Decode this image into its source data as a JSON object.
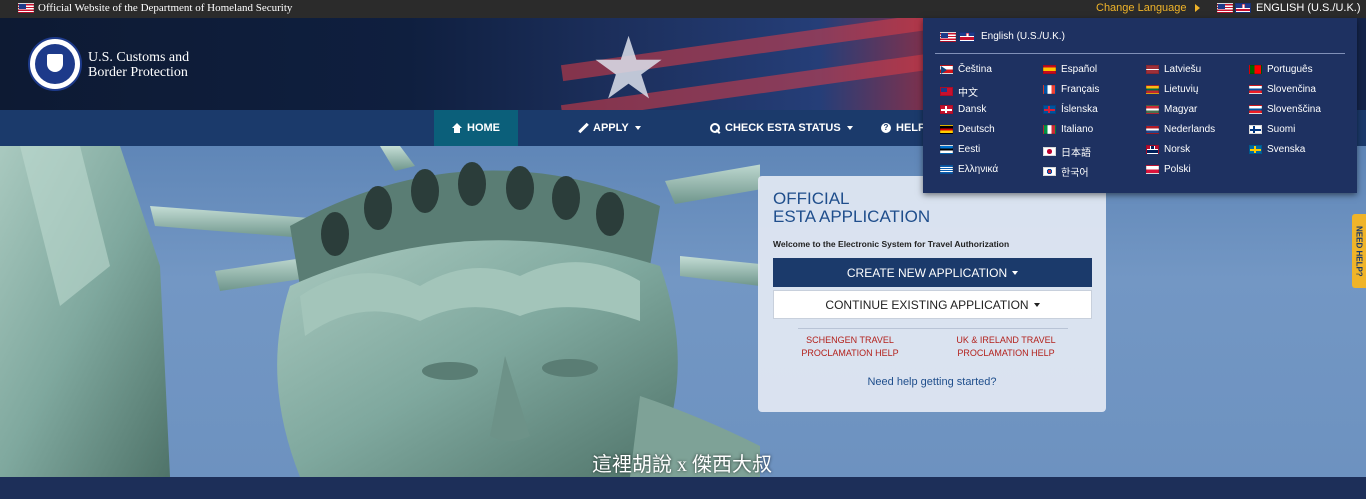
{
  "topbar": {
    "official_text": "Official Website of the Department of Homeland Security",
    "change_language": "Change Language",
    "current_language": "ENGLISH (U.S./U.K.)"
  },
  "header": {
    "brand_line1": "U.S. Customs and",
    "brand_line2": "Border Protection"
  },
  "nav": {
    "home": "HOME",
    "apply": "APPLY",
    "check_status": "CHECK ESTA STATUS",
    "help": "HELP"
  },
  "card": {
    "title_line1": "OFFICIAL",
    "title_line2": "ESTA APPLICATION",
    "welcome": "Welcome to the Electronic System for Travel Authorization",
    "create_button": "CREATE NEW APPLICATION",
    "continue_button": "CONTINUE EXISTING APPLICATION",
    "schengen_line1": "SCHENGEN TRAVEL",
    "schengen_line2": "PROCLAMATION HELP",
    "uk_line1": "UK & IRELAND TRAVEL",
    "uk_line2": "PROCLAMATION HELP",
    "getting_started": "Need help getting started?"
  },
  "side_tab": "NEED HELP?",
  "watermark": "這裡胡說 x 傑西大叔",
  "language_menu": {
    "current": "English (U.S./U.K.)",
    "languages": [
      {
        "label": "Čeština",
        "flag": "cz"
      },
      {
        "label": "Español",
        "flag": "es"
      },
      {
        "label": "Latviešu",
        "flag": "lv"
      },
      {
        "label": "Português",
        "flag": "pt"
      },
      {
        "label": "中文",
        "flag": "tw"
      },
      {
        "label": "Français",
        "flag": "fr"
      },
      {
        "label": "Lietuvių",
        "flag": "lt"
      },
      {
        "label": "Slovenčina",
        "flag": "sk"
      },
      {
        "label": "Dansk",
        "flag": "dk"
      },
      {
        "label": "Íslenska",
        "flag": "is"
      },
      {
        "label": "Magyar",
        "flag": "hu"
      },
      {
        "label": "Slovenščina",
        "flag": "si"
      },
      {
        "label": "Deutsch",
        "flag": "de"
      },
      {
        "label": "Italiano",
        "flag": "it"
      },
      {
        "label": "Nederlands",
        "flag": "nl"
      },
      {
        "label": "Suomi",
        "flag": "fi"
      },
      {
        "label": "Eesti",
        "flag": "ee"
      },
      {
        "label": "日本語",
        "flag": "jp"
      },
      {
        "label": "Norsk",
        "flag": "no"
      },
      {
        "label": "Svenska",
        "flag": "se"
      },
      {
        "label": "Ελληνικά",
        "flag": "gr"
      },
      {
        "label": "한국어",
        "flag": "kr"
      },
      {
        "label": "Polski",
        "flag": "pl"
      }
    ]
  },
  "colors": {
    "nav_blue": "#1b3a6b",
    "active_tab": "#0b5f7a",
    "accent_gold": "#f0b429",
    "link_red": "#b3211c",
    "title_blue": "#1f4e8c"
  }
}
